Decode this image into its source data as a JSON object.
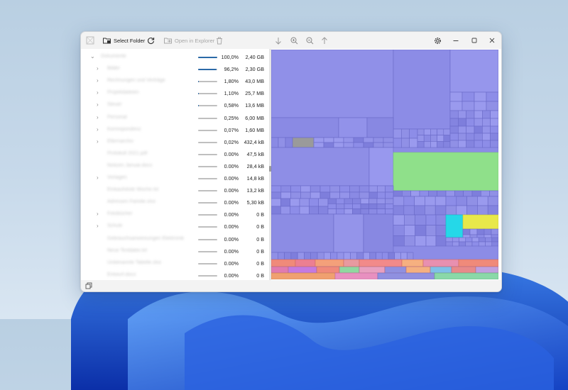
{
  "toolbar": {
    "select_folder_label": "Select Folder",
    "open_in_explorer_label": "Open in Explorer"
  },
  "tree": {
    "rows": [
      {
        "name": "Dokumente",
        "expander": "down",
        "indent": 0,
        "pct": "100,0%",
        "fill": 1.0,
        "size": "2,40 GB"
      },
      {
        "name": "Bilder",
        "expander": "right",
        "indent": 1,
        "pct": "96,2%",
        "fill": 0.962,
        "size": "2,30 GB"
      },
      {
        "name": "Rechnungen und Verträge",
        "expander": "right",
        "indent": 1,
        "pct": "1,80%",
        "fill": 0.018,
        "size": "43,0 MB"
      },
      {
        "name": "Projektdateien",
        "expander": "right",
        "indent": 1,
        "pct": "1,10%",
        "fill": 0.011,
        "size": "25,7 MB"
      },
      {
        "name": "Steuer",
        "expander": "right",
        "indent": 1,
        "pct": "0,58%",
        "fill": 0.0058,
        "size": "13,6 MB"
      },
      {
        "name": "Personal",
        "expander": "right",
        "indent": 1,
        "pct": "0,25%",
        "fill": 0.0025,
        "size": "6,00 MB"
      },
      {
        "name": "Korrespondenz",
        "expander": "right",
        "indent": 1,
        "pct": "0,07%",
        "fill": 0.0007,
        "size": "1,60 MB"
      },
      {
        "name": "Elternarchiv",
        "expander": "right",
        "indent": 1,
        "pct": "0,02%",
        "fill": 0.0002,
        "size": "432,4 kB"
      },
      {
        "name": "Protokoll 2021.pdf",
        "expander": "",
        "indent": 1,
        "pct": "0.00%",
        "fill": 0,
        "size": "47,5 kB"
      },
      {
        "name": "Notizen Januar.docx",
        "expander": "",
        "indent": 1,
        "pct": "0.00%",
        "fill": 0,
        "size": "28,4 kB"
      },
      {
        "name": "Vorlagen",
        "expander": "right",
        "indent": 1,
        "pct": "0.00%",
        "fill": 0,
        "size": "14,8 kB"
      },
      {
        "name": "Einkaufsliste Woche.txt",
        "expander": "",
        "indent": 1,
        "pct": "0.00%",
        "fill": 0,
        "size": "13,2 kB"
      },
      {
        "name": "Adressen Familie.xlsx",
        "expander": "",
        "indent": 1,
        "pct": "0.00%",
        "fill": 0,
        "size": "5,30 kB"
      },
      {
        "name": "Fotobücher",
        "expander": "right",
        "indent": 1,
        "pct": "0.00%",
        "fill": 0,
        "size": "0 B"
      },
      {
        "name": "Schule",
        "expander": "right",
        "indent": 1,
        "pct": "0.00%",
        "fill": 0,
        "size": "0 B"
      },
      {
        "name": "Gebrauchsanweisungen Elektronik",
        "expander": "",
        "indent": 1,
        "pct": "0.00%",
        "fill": 0,
        "size": "0 B"
      },
      {
        "name": "Neue Textdatei.txt",
        "expander": "",
        "indent": 1,
        "pct": "0.00%",
        "fill": 0,
        "size": "0 B"
      },
      {
        "name": "Unbenannte Tabelle.xlsx",
        "expander": "",
        "indent": 1,
        "pct": "0.00%",
        "fill": 0,
        "size": "0 B"
      },
      {
        "name": "Entwurf.docx",
        "expander": "",
        "indent": 1,
        "pct": "0.00%",
        "fill": 0,
        "size": "0 B"
      }
    ]
  },
  "colors": {
    "accent": "#2b6aa8",
    "treemap_base": "#8c8ce6",
    "treemap_green": "#8fe08a",
    "treemap_yellow": "#e8e84a",
    "treemap_cyan": "#25d8e8",
    "treemap_salmon": "#f08a7a"
  },
  "icons": {
    "app": "scan-icon",
    "select_folder": "folder-icon",
    "refresh": "refresh-icon",
    "open_in_explorer": "folder-open-icon",
    "delete": "trash-icon",
    "nav_down": "arrow-down-icon",
    "zoom_in": "zoom-in-icon",
    "zoom_out": "zoom-out-icon",
    "nav_up": "arrow-up-icon",
    "settings": "gear-icon",
    "minimize": "minimize-icon",
    "maximize": "maximize-icon",
    "close": "close-icon",
    "status": "copy-icon"
  }
}
